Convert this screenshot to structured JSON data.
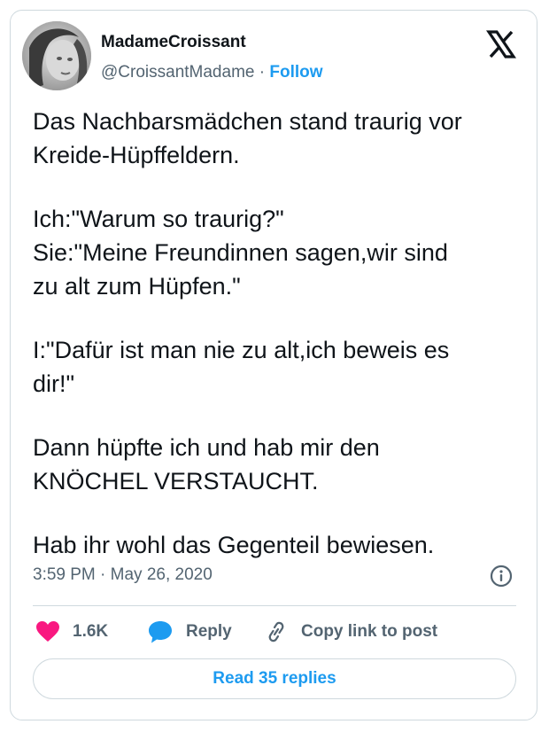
{
  "author": {
    "name": "MadameCroissant",
    "handle": "@CroissantMadame",
    "separator": "·",
    "follow_label": "Follow"
  },
  "tweet": {
    "paragraphs": [
      [
        "Das Nachbarsmädchen stand traurig vor",
        "Kreide-Hüpffeldern."
      ],
      [
        "Ich:\"Warum so traurig?\"",
        "Sie:\"Meine Freundinnen sagen,wir sind",
        "zu alt zum Hüpfen.\""
      ],
      [
        "I:\"Dafür ist man nie zu alt,ich beweis es",
        "dir!\""
      ],
      [
        "Dann hüpfte ich und hab mir den",
        "KNÖCHEL VERSTAUCHT."
      ],
      [
        "Hab ihr wohl das Gegenteil bewiesen."
      ]
    ],
    "time": "3:59 PM",
    "date_separator": "·",
    "date": "May 26, 2020"
  },
  "actions": {
    "likes": "1.6K",
    "reply": "Reply",
    "copy_link": "Copy link to post",
    "read_replies": "Read 35 replies"
  },
  "icons": {
    "logo": "x-logo-icon",
    "info": "info-icon",
    "heart": "heart-icon",
    "reply": "reply-bubble-icon",
    "link": "link-icon"
  },
  "colors": {
    "accent": "#1d9bf0",
    "heart": "#f91880",
    "text": "#0f1419",
    "muted": "#536471",
    "border": "#cfd9de"
  }
}
